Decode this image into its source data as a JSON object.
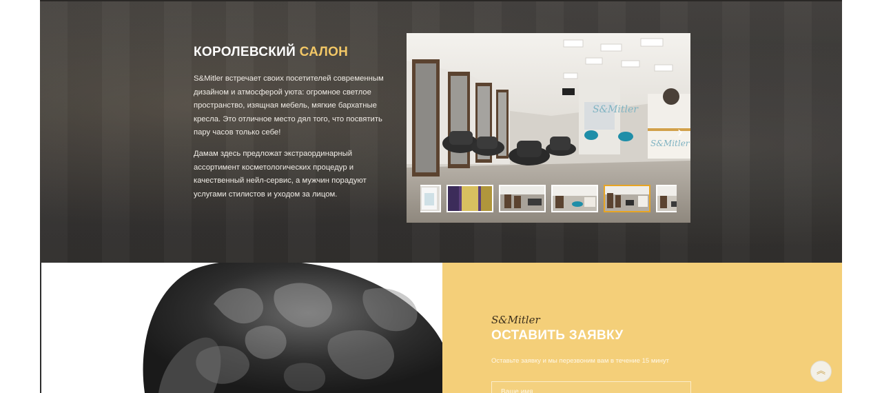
{
  "salon_section": {
    "title_part1": "КОРОЛЕВСКИЙ",
    "title_part2": "САЛОН",
    "paragraph1": "S&Mitler встречает своих посетителей современным дизайном и атмосферой уюта: огромное светлое пространство, изящная мебель, мягкие бархатные кресла. Это отличное место дял того, что посвятить пару часов только себе!",
    "paragraph2": "Дамам здесь предложат экстраординарный ассортимент косметологических процедур и качественный нейл-сервис, а мужчин порадуют услугами стилистов и уходом за лицом.",
    "accent_color": "#f2c766"
  },
  "gallery": {
    "photo_sign": "S&Mitler",
    "next_icon": "chevron-right-icon",
    "thumbnails": [
      {
        "name": "thumb-1",
        "active": false
      },
      {
        "name": "thumb-2",
        "active": false
      },
      {
        "name": "thumb-3",
        "active": false
      },
      {
        "name": "thumb-4",
        "active": false
      },
      {
        "name": "thumb-5",
        "active": true
      },
      {
        "name": "thumb-6",
        "active": false
      }
    ],
    "active_border_color": "#e8a523"
  },
  "order_section": {
    "brand": "S&Mitler",
    "title": "ОСТАВИТЬ ЗАЯВКУ",
    "subtitle": "Оставьте заявку и мы перезвоним вам в течение 15 минут",
    "name_placeholder": "Ваше имя",
    "background_color": "#f4cf79"
  },
  "scroll_top": {
    "icon": "double-chevron-up-icon"
  }
}
